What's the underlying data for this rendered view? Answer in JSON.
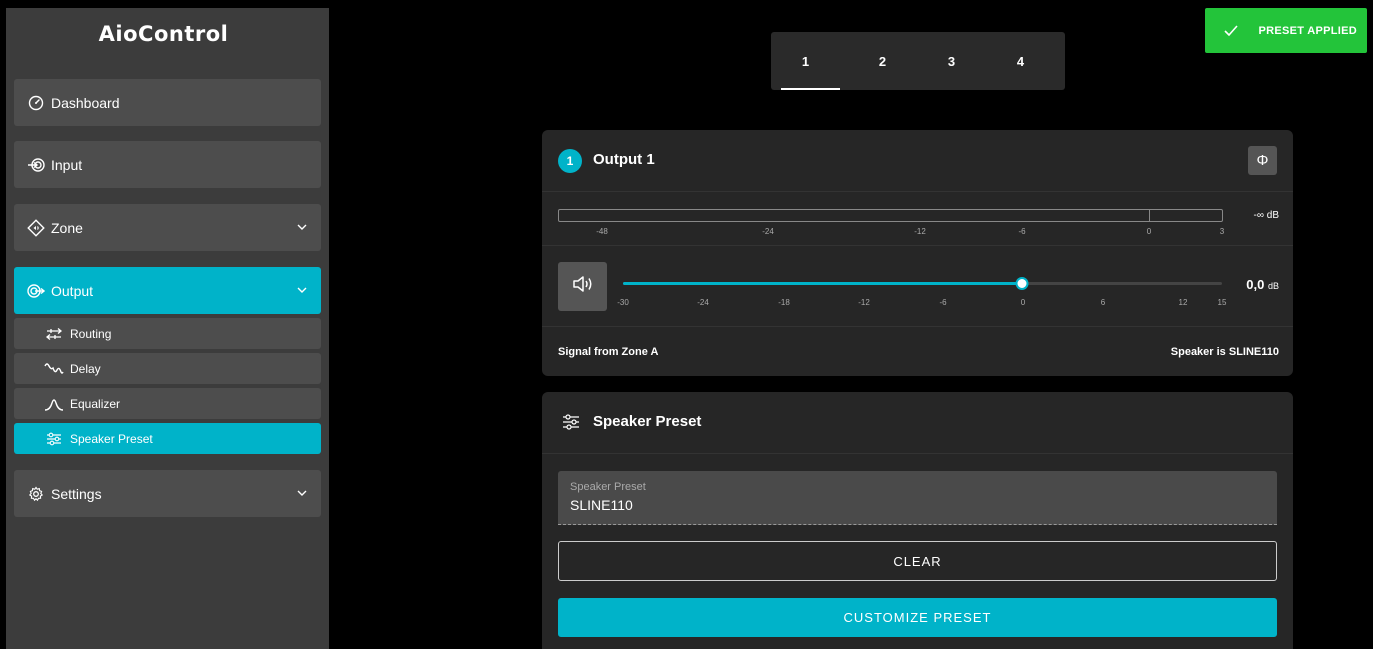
{
  "app": {
    "title": "AioControl"
  },
  "sidebar": {
    "items": [
      {
        "label": "Dashboard",
        "icon": "gauge-icon"
      },
      {
        "label": "Input",
        "icon": "input-icon"
      },
      {
        "label": "Zone",
        "icon": "zone-icon"
      },
      {
        "label": "Output",
        "icon": "output-icon"
      },
      {
        "label": "Settings",
        "icon": "gear-icon"
      }
    ],
    "sub_items": [
      {
        "label": "Routing",
        "icon": "routing-icon"
      },
      {
        "label": "Delay",
        "icon": "delay-icon"
      },
      {
        "label": "Equalizer",
        "icon": "equalizer-icon"
      },
      {
        "label": "Speaker Preset",
        "icon": "sliders-icon"
      }
    ]
  },
  "tabs": [
    "1",
    "2",
    "3",
    "4"
  ],
  "toast": {
    "text": "PRESET APPLIED",
    "color": "#23c43a"
  },
  "output_card": {
    "badge": "1",
    "title": "Output 1",
    "phase_symbol": "Φ",
    "meter": {
      "value_text": "-∞ dB",
      "ticks": [
        "-48",
        "-24",
        "-12",
        "-6",
        "0",
        "3"
      ]
    },
    "volume": {
      "value": "0,0",
      "unit": "dB",
      "level_db": 0,
      "range_db": [
        -30,
        15
      ],
      "ticks": [
        "-30",
        "-24",
        "-18",
        "-12",
        "-6",
        "0",
        "6",
        "12",
        "15"
      ]
    },
    "signal_text": "Signal from Zone A",
    "speaker_text": "Speaker is SLINE110"
  },
  "preset_card": {
    "title": "Speaker Preset",
    "field_label": "Speaker Preset",
    "field_value": "SLINE110",
    "clear_label": "CLEAR",
    "customize_label": "CUSTOMIZE PRESET"
  },
  "colors": {
    "accent": "#00b3c9",
    "success": "#23c43a"
  }
}
